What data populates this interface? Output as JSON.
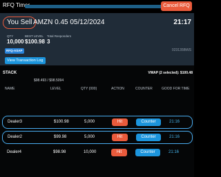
{
  "titlebar": {
    "title": "RFQ Timer",
    "cancel_label": "Cancel RFQ",
    "timer_remaining_fraction": 0
  },
  "header": {
    "side": "You Sell",
    "instrument": "AMZN 0.45 05/12/2024",
    "time": "21:17",
    "stats": [
      {
        "label": "QTY",
        "value": "10,000"
      },
      {
        "label": "BEST LEVEL",
        "value": "$100.98"
      },
      {
        "label": "Total Responders",
        "value": "3"
      }
    ],
    "tag": "RFQ-ASAP",
    "ref": "023135BWS",
    "view_log_label": "View Transaction Log"
  },
  "stack": {
    "title": "STACK",
    "vwap": "VWAP (2 selected): $100.48",
    "range": "$98.493 / $98.5094",
    "columns": [
      "NAME",
      "LEVEL",
      "QTY (000)",
      "ACTION",
      "COUNTER",
      "GOOD FOR TIME"
    ],
    "rows": [
      {
        "name": "Dealer3",
        "level": "$100.98",
        "qty": "5,000",
        "hit": "Hit",
        "counter": "Counter",
        "time": "21:16",
        "selected": true
      },
      {
        "name": "Dealer2",
        "level": "$99.98",
        "qty": "5,000",
        "hit": "Hit",
        "counter": "Counter",
        "time": "21:16",
        "selected": true
      },
      {
        "name": "Dealer4",
        "level": "$98.98",
        "qty": "10,000",
        "hit": "Hit",
        "counter": "Counter",
        "time": "21:16",
        "selected": false
      }
    ]
  },
  "colors": {
    "accent_red": "#ea5b3c",
    "accent_blue": "#1c95dd",
    "time_blue": "#46b6ee",
    "header_bg": "#202c38"
  }
}
